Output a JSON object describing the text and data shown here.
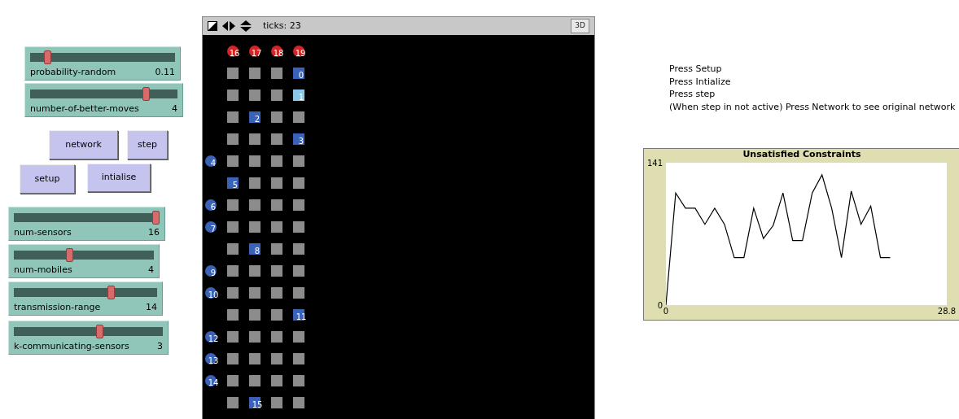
{
  "sliders_top": [
    {
      "label": "probability-random",
      "value": "0.11",
      "level": 0.1
    },
    {
      "label": "number-of-better-moves",
      "value": "4",
      "level": 0.8
    }
  ],
  "buttons": [
    {
      "label": "network"
    },
    {
      "label": "step"
    },
    {
      "label": "setup"
    },
    {
      "label": "intialise"
    }
  ],
  "sliders_bottom": [
    {
      "label": "num-sensors",
      "value": "16",
      "level": 1.0
    },
    {
      "label": "num-mobiles",
      "value": "4",
      "level": 0.39
    },
    {
      "label": "transmission-range",
      "value": "14",
      "level": 0.69
    },
    {
      "label": "k-communicating-sensors",
      "value": "3",
      "level": 0.58
    }
  ],
  "view": {
    "ticks": "ticks: 23",
    "button_3d": "3D",
    "rows": [
      {
        "cells": [
          {
            "kind": "mobile",
            "label": "16",
            "color": "#d42424"
          },
          {
            "kind": "mobile",
            "label": "17",
            "color": "#d42424"
          },
          {
            "kind": "mobile",
            "label": "18",
            "color": "#d42424"
          },
          {
            "kind": "mobile",
            "label": "19",
            "color": "#d42424"
          }
        ]
      },
      {
        "cells": [
          {
            "kind": "patch"
          },
          {
            "kind": "patch"
          },
          {
            "kind": "patch"
          },
          {
            "kind": "sensor",
            "label": "0",
            "color": "#3a62b8"
          }
        ]
      },
      {
        "cells": [
          {
            "kind": "patch"
          },
          {
            "kind": "patch"
          },
          {
            "kind": "patch"
          },
          {
            "kind": "sensor",
            "label": "1",
            "color": "#8cc8ea"
          }
        ]
      },
      {
        "cells": [
          {
            "kind": "patch"
          },
          {
            "kind": "sensor",
            "label": "2",
            "color": "#3a62b8"
          },
          {
            "kind": "patch"
          },
          {
            "kind": "patch"
          }
        ]
      },
      {
        "cells": [
          {
            "kind": "patch"
          },
          {
            "kind": "patch"
          },
          {
            "kind": "patch"
          },
          {
            "kind": "sensor",
            "label": "3",
            "color": "#3a62b8"
          }
        ]
      },
      {
        "side": {
          "label": "4",
          "color": "#3a62b8"
        },
        "cells": [
          {
            "kind": "patch"
          },
          {
            "kind": "patch"
          },
          {
            "kind": "patch"
          },
          {
            "kind": "patch"
          }
        ]
      },
      {
        "cells": [
          {
            "kind": "sensor",
            "label": "5",
            "color": "#3a62b8"
          },
          {
            "kind": "patch"
          },
          {
            "kind": "patch"
          },
          {
            "kind": "patch"
          }
        ]
      },
      {
        "side": {
          "label": "6",
          "color": "#3a62b8"
        },
        "cells": [
          {
            "kind": "patch"
          },
          {
            "kind": "patch"
          },
          {
            "kind": "patch"
          },
          {
            "kind": "patch"
          }
        ]
      },
      {
        "side": {
          "label": "7",
          "color": "#3a62b8"
        },
        "cells": [
          {
            "kind": "patch"
          },
          {
            "kind": "patch"
          },
          {
            "kind": "patch"
          },
          {
            "kind": "patch"
          }
        ]
      },
      {
        "cells": [
          {
            "kind": "patch"
          },
          {
            "kind": "sensor",
            "label": "8",
            "color": "#3a62b8"
          },
          {
            "kind": "patch"
          },
          {
            "kind": "patch"
          }
        ]
      },
      {
        "side": {
          "label": "9",
          "color": "#3a62b8"
        },
        "cells": [
          {
            "kind": "patch"
          },
          {
            "kind": "patch"
          },
          {
            "kind": "patch"
          },
          {
            "kind": "patch"
          }
        ]
      },
      {
        "side": {
          "label": "10",
          "color": "#3a62b8"
        },
        "cells": [
          {
            "kind": "patch"
          },
          {
            "kind": "patch"
          },
          {
            "kind": "patch"
          },
          {
            "kind": "patch"
          }
        ]
      },
      {
        "cells": [
          {
            "kind": "patch"
          },
          {
            "kind": "patch"
          },
          {
            "kind": "patch"
          },
          {
            "kind": "sensor",
            "label": "11",
            "color": "#3a62b8"
          }
        ]
      },
      {
        "side": {
          "label": "12",
          "color": "#3a62b8"
        },
        "cells": [
          {
            "kind": "patch"
          },
          {
            "kind": "patch"
          },
          {
            "kind": "patch"
          },
          {
            "kind": "patch"
          }
        ]
      },
      {
        "side": {
          "label": "13",
          "color": "#3a62b8"
        },
        "cells": [
          {
            "kind": "patch"
          },
          {
            "kind": "patch"
          },
          {
            "kind": "patch"
          },
          {
            "kind": "patch"
          }
        ]
      },
      {
        "side": {
          "label": "14",
          "color": "#3a62b8"
        },
        "cells": [
          {
            "kind": "patch"
          },
          {
            "kind": "patch"
          },
          {
            "kind": "patch"
          },
          {
            "kind": "patch"
          }
        ]
      },
      {
        "cells": [
          {
            "kind": "patch"
          },
          {
            "kind": "sensor",
            "label": "15",
            "color": "#3a62b8"
          },
          {
            "kind": "patch"
          },
          {
            "kind": "patch"
          }
        ]
      }
    ]
  },
  "notes": [
    "Press Setup",
    "Press Intialize",
    "Press step",
    "(When step in not active) Press Network to see original network"
  ],
  "plot": {
    "chart_data": {
      "type": "line",
      "title": "Unsatisfied Constraints",
      "x": [
        0,
        1,
        2,
        3,
        4,
        5,
        6,
        7,
        8,
        9,
        10,
        11,
        12,
        13,
        14,
        15,
        16,
        17,
        18,
        19,
        20,
        21,
        22,
        23
      ],
      "series": [
        {
          "color": "#000000",
          "values": [
            0,
            111,
            96,
            96,
            80,
            96,
            80,
            47,
            47,
            96,
            66,
            79,
            111,
            64,
            64,
            111,
            129,
            96,
            47,
            113,
            80,
            98,
            47,
            47
          ]
        }
      ],
      "xlim": [
        0,
        28.8
      ],
      "ylim": [
        0,
        141
      ],
      "xticks": [
        {
          "value": 0,
          "label": "0"
        },
        {
          "value": 28.8,
          "label": "28.8"
        }
      ],
      "yticks": [
        {
          "value": 0,
          "label": "0"
        },
        {
          "value": 141,
          "label": "141"
        }
      ]
    }
  }
}
